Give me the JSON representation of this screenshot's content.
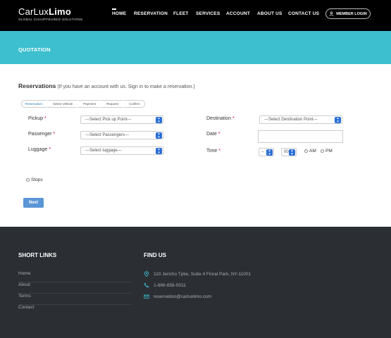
{
  "header": {
    "logo_text_a": "CarLux",
    "logo_text_b": "Limo",
    "logo_tagline": "GLOBAL CHAUFFEURED SOLUTIONS",
    "nav": [
      "HOME",
      "RESERVATION",
      "FLEET",
      "SERVICES",
      "ACCOUNT",
      "ABOUT US",
      "CONTACT US"
    ],
    "member_login": "MEMBER LOGIN"
  },
  "banner": {
    "title": "QUOTATION"
  },
  "reservations": {
    "heading": "Reservations",
    "note": " (If you have an account with us. Sign in to make a reservation.)"
  },
  "steps": [
    "Reservation",
    "Select Vehicle",
    "Payment",
    "Request",
    "Confirm"
  ],
  "form": {
    "pickup_label": "Pickup",
    "pickup_value": "---Select Pick up Point---",
    "passenger_label": "Passenger",
    "passenger_value": "---Select Passengers---",
    "luggage_label": "Luggage",
    "luggage_value": "---Select luggage---",
    "destination_label": "Destination",
    "destination_value": "---Select Destination Point---",
    "date_label": "Date",
    "time_label": "Time",
    "hour_value": "--",
    "minute_value": "00",
    "am_label": "AM",
    "pm_label": "PM",
    "required_mark": "*",
    "stops_label": "Stops",
    "next_button": "Next"
  },
  "footer": {
    "short_links_title": "SHORT LINKS",
    "links": [
      "Home",
      "About",
      "Terms",
      "Contact"
    ],
    "find_us_title": "FIND US",
    "address": "110 Jericho Tpke, Suite 4 Floral Park, NY-11001",
    "phone": "1-866-658-0011",
    "email": "reservation@carluxlimo.com"
  },
  "colors": {
    "header_bg": "#000000",
    "banner_bg": "#3dbfcf",
    "accent_blue": "#2a6fd6",
    "footer_bg": "#2b2f34"
  }
}
